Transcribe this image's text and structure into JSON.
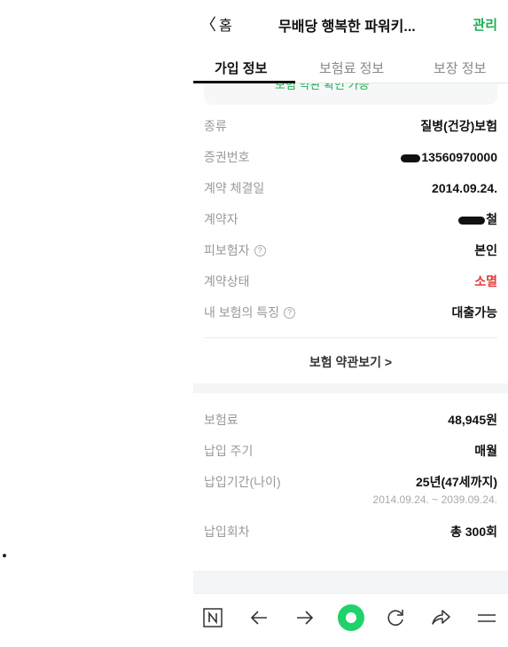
{
  "header": {
    "back_chevron": "〈",
    "back_label": "홈",
    "title": "무배당 행복한 파워키...",
    "manage_label": "관리"
  },
  "tabs": [
    {
      "label": "가입 정보",
      "active": true
    },
    {
      "label": "보험료 정보",
      "active": false
    },
    {
      "label": "보장 정보",
      "active": false
    }
  ],
  "peek_text": "보험 약관 확인 가능",
  "contract": {
    "type": {
      "label": "종류",
      "value": "질병(건강)보험"
    },
    "policy_number": {
      "label": "증권번호",
      "value": "13560970000"
    },
    "contract_date": {
      "label": "계약 체결일",
      "value": "2014.09.24."
    },
    "contractor": {
      "label": "계약자",
      "value": "철"
    },
    "insured": {
      "label": "피보험자",
      "value": "본인"
    },
    "status": {
      "label": "계약상태",
      "value": "소멸"
    },
    "features": {
      "label": "내 보험의 특징",
      "value": "대출가능"
    }
  },
  "terms_link": "보험 약관보기 >",
  "payment": {
    "premium": {
      "label": "보험료",
      "value": "48,945원"
    },
    "cycle": {
      "label": "납입 주기",
      "value": "매월"
    },
    "period": {
      "label": "납입기간(나이)",
      "value": "25년(47세까지)",
      "sub_value": "2014.09.24. ~ 2039.09.24."
    },
    "count": {
      "label": "납입회차",
      "value": "총 300회"
    }
  },
  "help_glyph": "?",
  "bottom_nav": [
    "n-logo-icon",
    "arrow-left-icon",
    "arrow-right-icon",
    "home-dot-icon",
    "refresh-icon",
    "share-icon",
    "menu-icon"
  ],
  "colors": {
    "accent": "#1aae52",
    "danger": "#e23a3a",
    "band": "#f4f5f6"
  }
}
